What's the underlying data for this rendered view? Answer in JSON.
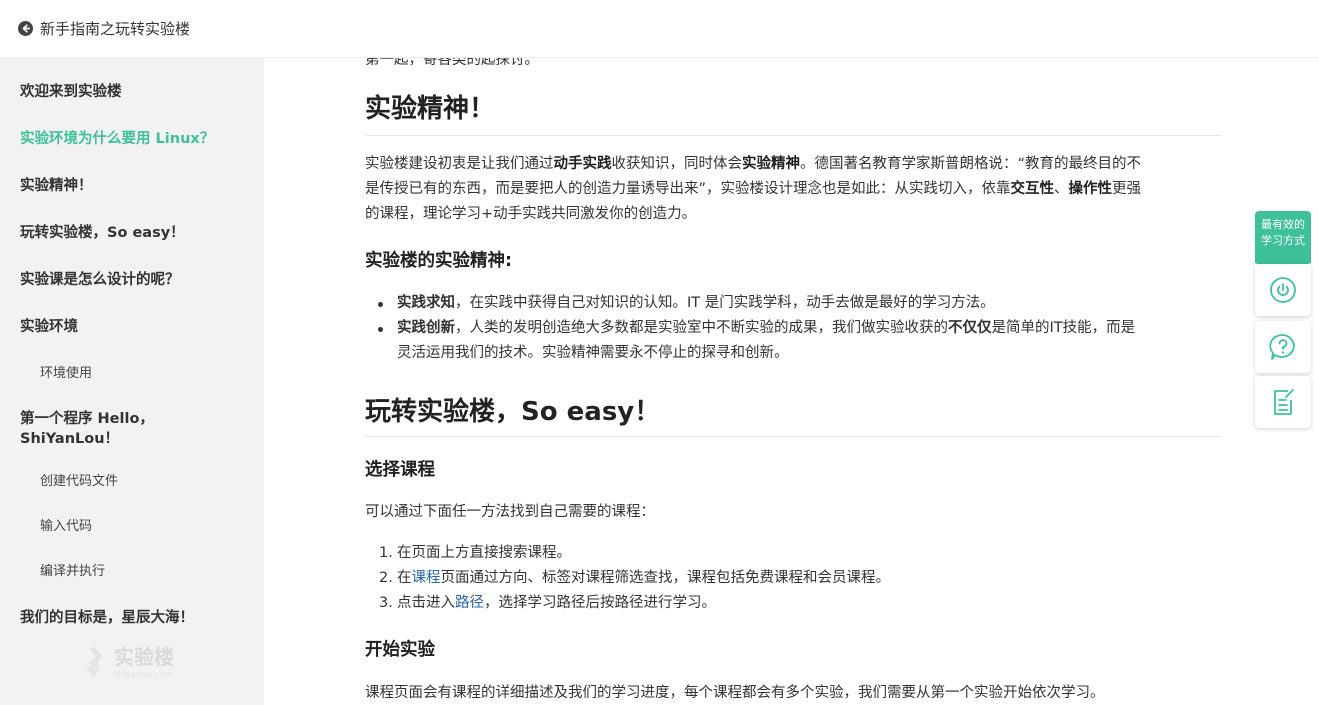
{
  "header": {
    "title": "新手指南之玩转实验楼",
    "back_icon": "back-arrow-circle-icon"
  },
  "sidebar": {
    "items": [
      {
        "label": "欢迎来到实验楼",
        "level": 1,
        "active": false
      },
      {
        "label": "实验环境为什么要用 Linux？",
        "level": 1,
        "active": true
      },
      {
        "label": "实验精神！",
        "level": 1,
        "active": false
      },
      {
        "label": "玩转实验楼，So easy！",
        "level": 1,
        "active": false
      },
      {
        "label": "实验课是怎么设计的呢？",
        "level": 1,
        "active": false
      },
      {
        "label": "实验环境",
        "level": 1,
        "active": false
      },
      {
        "label": "环境使用",
        "level": 2,
        "active": false
      },
      {
        "label": "第一个程序 Hello，",
        "label2": "ShiYanLou！",
        "level": 1,
        "active": false
      },
      {
        "label": "创建代码文件",
        "level": 2,
        "active": false
      },
      {
        "label": "输入代码",
        "level": 2,
        "active": false
      },
      {
        "label": "编译并执行",
        "level": 2,
        "active": false
      },
      {
        "label": "我们的目标是，星辰大海！",
        "level": 1,
        "active": false
      }
    ],
    "watermark": {
      "text": "实验楼",
      "sub": "shiyanlou.com"
    }
  },
  "content": {
    "clipped_line": "第一起，寄各类的起探讨。",
    "section1": {
      "title": "实验精神！",
      "p1": {
        "t1": "实验楼建设初衷是让我们通过",
        "b1": "动手实践",
        "t2": "收获知识，同时体会",
        "b2": "实验精神",
        "t3": "。德国著名教育学家斯普朗格说：“教育的最终目的不",
        "t4": "是传授已有的东西，而是要把人的创造力量诱导出来”，实验楼设计理念也是如此：从实践切入，依靠",
        "b3": "交互性",
        "t5": "、",
        "b4": "操作性",
        "t6": "更强",
        "t7": "的课程，理论学习+动手实践共同激发你的创造力。"
      },
      "subtitle": "实验楼的实验精神:",
      "bullets": [
        {
          "bold": "实践求知",
          "text": "，在实践中获得自己对知识的认知。IT 是门实践学科，动手去做是最好的学习方法。"
        },
        {
          "bold": "实践创新",
          "text": "，人类的发明创造绝大多数都是实验室中不断实验的成果，我们做实验收获的",
          "bold2": "不仅仅",
          "text2": "是简单的IT技能，而是",
          "text3": "灵活运用我们的技术。实验精神需要永不停止的探寻和创新。"
        }
      ]
    },
    "section2": {
      "title": "玩转实验楼，So easy！",
      "sub1": "选择课程",
      "intro": "可以通过下面任一方法找到自己需要的课程：",
      "steps": [
        {
          "num": "1.",
          "pre": "在页面上方直接搜索课程。",
          "link": "",
          "post": ""
        },
        {
          "num": "2.",
          "pre": "在",
          "link": "课程",
          "post": "页面通过方向、标签对课程筛选查找，课程包括免费课程和会员课程。"
        },
        {
          "num": "3.",
          "pre": "点击进入",
          "link": "路径",
          "post": "，选择学习路径后按路径进行学习。"
        }
      ],
      "sub2": "开始实验",
      "last_para": "课程页面会有课程的详细描述及我们的学习进度，每个课程都会有多个实验，我们需要从第一个实验开始依次学习。"
    }
  },
  "float_tools": {
    "ribbon_line1": "最有效的",
    "ribbon_line2": "学习方式",
    "buttons": [
      "power-icon",
      "help-icon",
      "notes-icon"
    ]
  },
  "colors": {
    "accent": "#3ec19a",
    "link": "#2a66a8",
    "sidebar_bg": "#f2f2f2"
  }
}
